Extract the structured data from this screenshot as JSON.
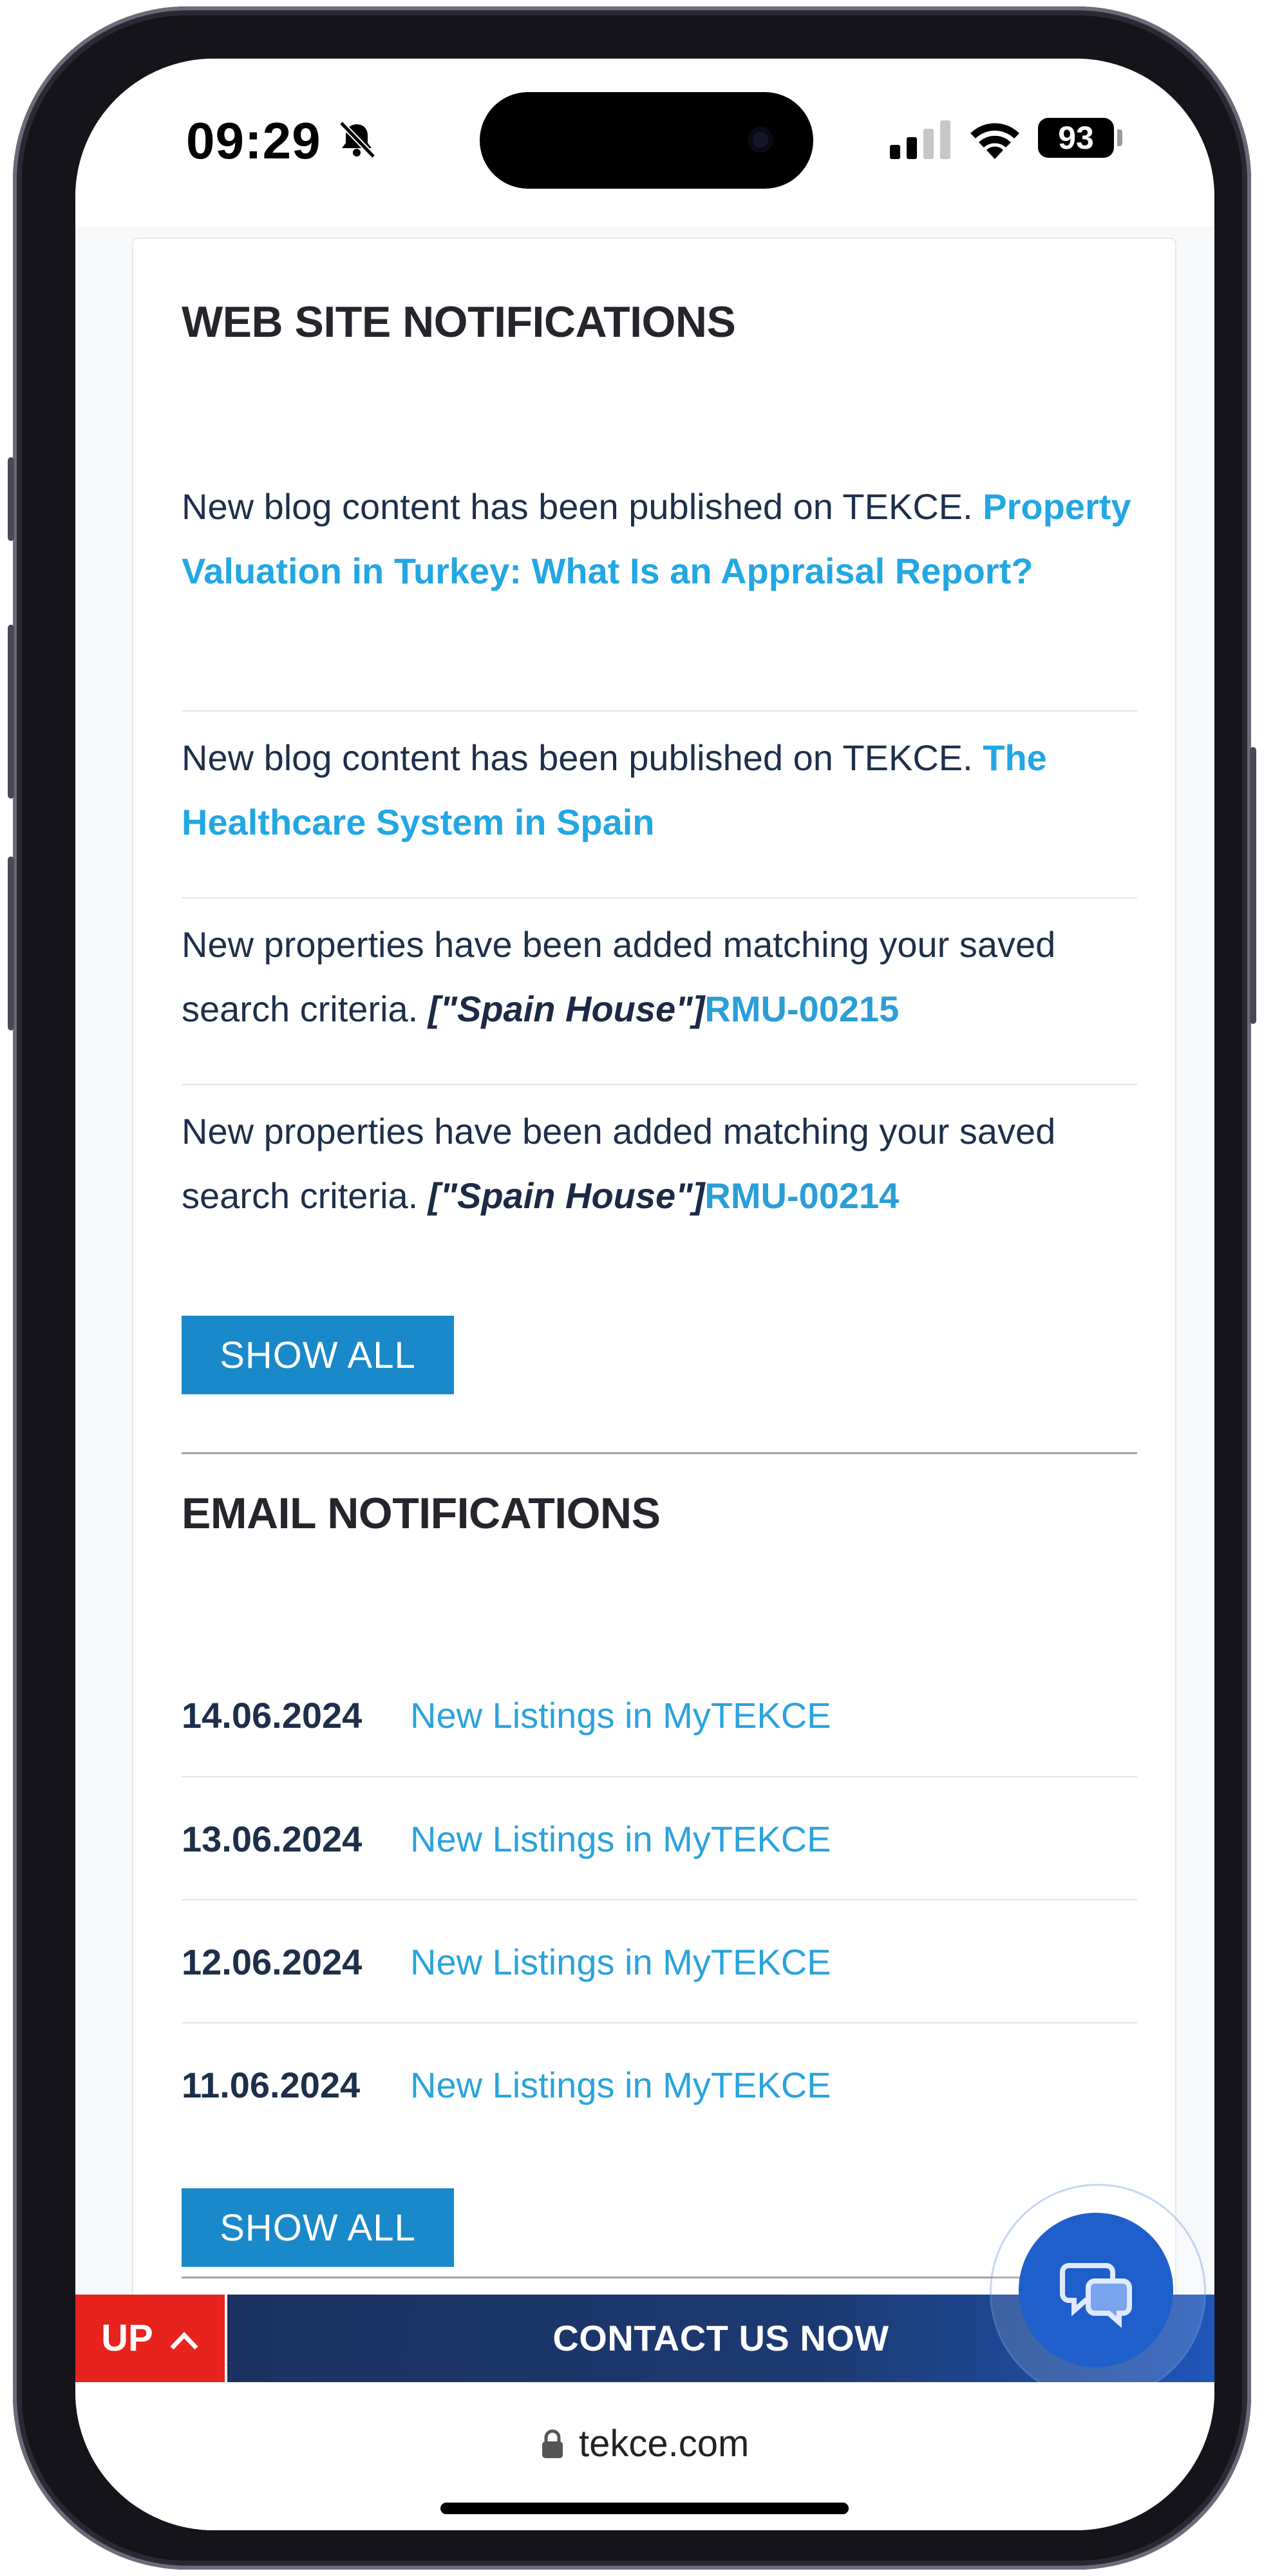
{
  "status_bar": {
    "time": "09:29",
    "battery": "93",
    "icons": [
      "bell-slash-icon",
      "signal-icon",
      "wifi-icon",
      "battery-icon"
    ]
  },
  "web_notifications": {
    "title": "WEB SITE NOTIFICATIONS",
    "items": [
      {
        "text": "New blog content has been published on TEKCE. ",
        "link": "Property Valuation in Turkey: What Is an Appraisal Report?"
      },
      {
        "text": "New blog content has been published on TEKCE. ",
        "link": "The Healthcare System in Spain"
      },
      {
        "text": "New properties have been added matching your saved search criteria. ",
        "tag": "[\"Spain House\"]",
        "code": "RMU-00215"
      },
      {
        "text": "New properties have been added matching your saved search criteria. ",
        "tag": "[\"Spain House\"]",
        "code": "RMU-00214"
      }
    ],
    "show_all_label": "SHOW ALL"
  },
  "email_notifications": {
    "title": "EMAIL NOTIFICATIONS",
    "items": [
      {
        "date": "14.06.2024",
        "link": "New Listings in MyTEKCE"
      },
      {
        "date": "13.06.2024",
        "link": "New Listings in MyTEKCE"
      },
      {
        "date": "12.06.2024",
        "link": "New Listings in MyTEKCE"
      },
      {
        "date": "11.06.2024",
        "link": "New Listings in MyTEKCE"
      }
    ],
    "show_all_label": "SHOW ALL"
  },
  "bottom_bar": {
    "up_label": "UP",
    "up_icon": "chevron-up-icon",
    "contact_label": "CONTACT US NOW",
    "chat_icon": "chat-bubbles-icon"
  },
  "browser": {
    "url": "tekce.com",
    "lock_icon": "lock-icon"
  },
  "colors": {
    "accent_blue": "#1a89c9",
    "link_blue": "#23a7e3",
    "up_red": "#e8221c",
    "contact_navy": "#1b3160",
    "chat_blue": "#1f5fcc"
  }
}
